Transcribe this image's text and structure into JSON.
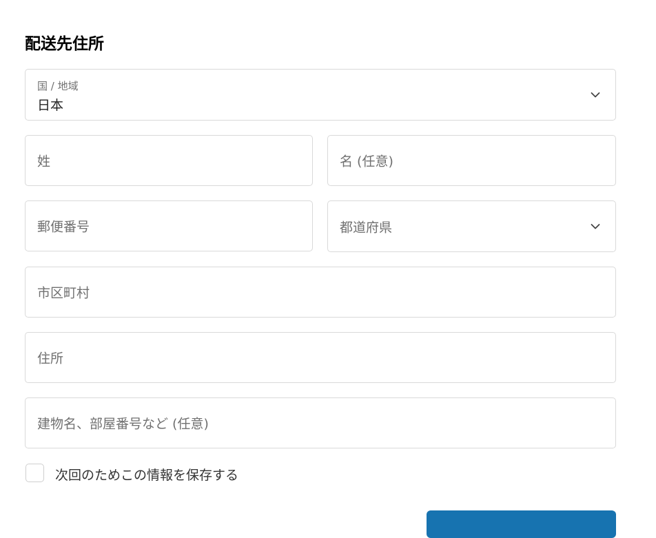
{
  "section": {
    "title": "配送先住所"
  },
  "country": {
    "label": "国 / 地域",
    "value": "日本"
  },
  "last_name": {
    "placeholder": "姓"
  },
  "first_name": {
    "placeholder": "名 (任意)"
  },
  "postal_code": {
    "placeholder": "郵便番号"
  },
  "prefecture": {
    "placeholder": "都道府県"
  },
  "city": {
    "placeholder": "市区町村"
  },
  "address": {
    "placeholder": "住所"
  },
  "building": {
    "placeholder": "建物名、部屋番号など (任意)"
  },
  "save_info": {
    "label": "次回のためこの情報を保存する",
    "checked": false
  },
  "colors": {
    "accent": "#1773b0",
    "border": "#d9d9d9",
    "placeholder": "#707070"
  }
}
